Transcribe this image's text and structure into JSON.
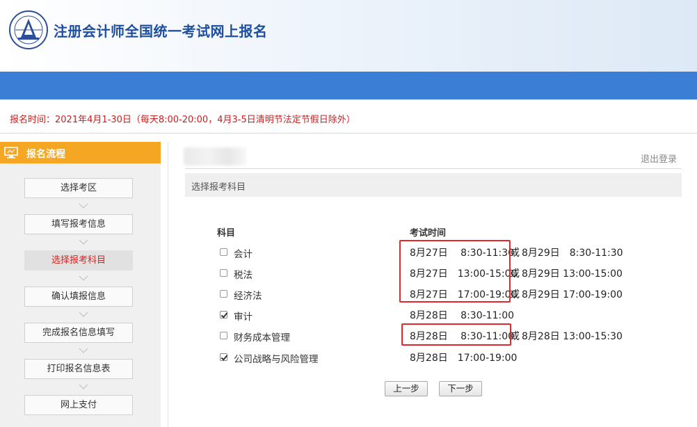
{
  "header": {
    "title": "注册会计师全国统一考试网上报名",
    "logo": "cicpa-seal-logo"
  },
  "notice": "报名时间：2021年4月1-30日（每天8:00-20:00，4月3-5日清明节法定节假日除外）",
  "sidebar": {
    "heading": "报名流程",
    "steps": [
      {
        "label": "选择考区",
        "active": false
      },
      {
        "label": "填写报考信息",
        "active": false
      },
      {
        "label": "选择报考科目",
        "active": true
      },
      {
        "label": "确认填报信息",
        "active": false
      },
      {
        "label": "完成报名信息填写",
        "active": false
      },
      {
        "label": "打印报名信息表",
        "active": false
      },
      {
        "label": "网上支付",
        "active": false
      }
    ]
  },
  "content": {
    "logout": "退出登录",
    "section_title": "选择报考科目",
    "col_subject": "科目",
    "col_time": "考试时间",
    "or_label": "或",
    "subjects": [
      {
        "name": "会计",
        "checked": false,
        "time1": "8月27日　 8:30-11:30",
        "time2": "8月29日　8:30-11:30"
      },
      {
        "name": "税法",
        "checked": false,
        "time1": "8月27日　13:00-15:00",
        "time2": "8月29日 13:00-15:00"
      },
      {
        "name": "经济法",
        "checked": false,
        "time1": "8月27日　17:00-19:00",
        "time2": "8月29日 17:00-19:00"
      },
      {
        "name": "审计",
        "checked": true,
        "time1": "8月28日　 8:30-11:00",
        "time2": ""
      },
      {
        "name": "财务成本管理",
        "checked": false,
        "time1": "8月28日　 8:30-11:00",
        "time2": "8月28日 13:00-15:30"
      },
      {
        "name": "公司战略与风险管理",
        "checked": true,
        "time1": "8月28日　17:00-19:00",
        "time2": ""
      }
    ],
    "prev_button": "上一步",
    "next_button": "下一步"
  },
  "colors": {
    "brand_blue": "#3a7fd5",
    "title_blue": "#1f4fa0",
    "sidebar_orange": "#f5a623",
    "notice_red": "#c81f1f",
    "highlight_red": "#e3262b"
  }
}
